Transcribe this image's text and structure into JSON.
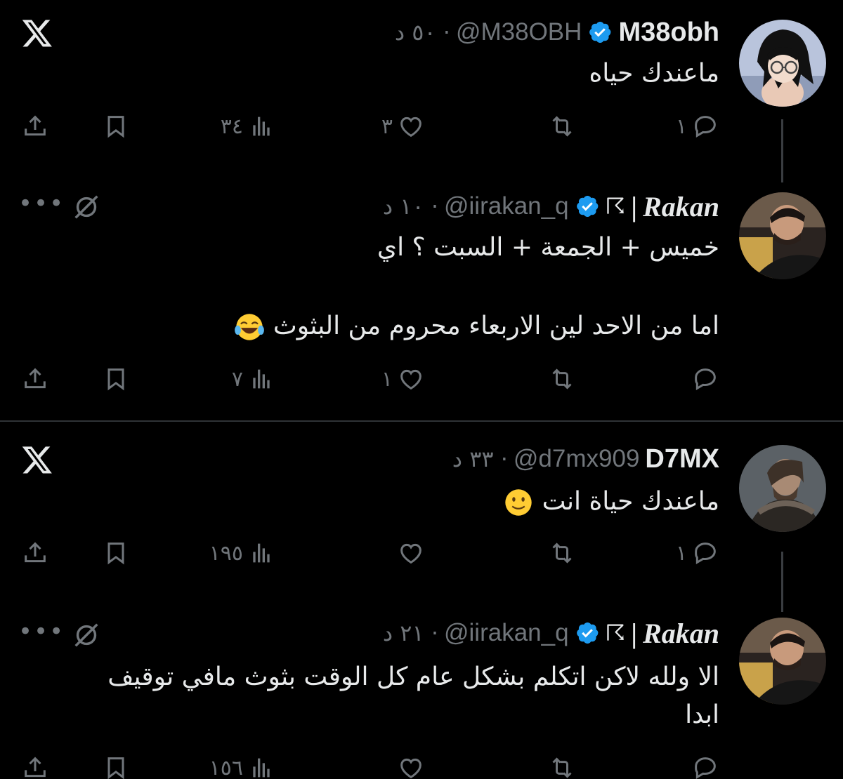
{
  "colors": {
    "background": "#000000",
    "text": "#e7e9ea",
    "secondary": "#71767b",
    "verified": "#1d9bf0",
    "divider": "#2f3336"
  },
  "post1": {
    "name": "M38obh",
    "handle": "@M38OBH",
    "time": "· ٥٠ د",
    "text": "ماعندك حياه",
    "reply_count": "١",
    "like_count": "٣",
    "views": "٣٤",
    "icons": [
      "x-logo-icon",
      "verified-badge-icon",
      "reply-icon",
      "retweet-icon",
      "like-icon",
      "views-icon",
      "bookmark-icon",
      "share-icon"
    ]
  },
  "reply1": {
    "name": "Rakan",
    "separator": "|",
    "flag": "☈",
    "handle": "@iirakan_q",
    "time": "· ١٠ د",
    "text_line1": "خميس + الجمعة + السبت ؟ اي",
    "text_line2": "اما من الاحد لين الاربعاء محروم من البثوث",
    "reply_count": "",
    "like_count": "١",
    "views": "٧",
    "icons": [
      "more-icon",
      "muted-icon",
      "laughing-emoji-icon"
    ]
  },
  "post2": {
    "name": "D7MX",
    "handle": "@d7mx909",
    "time": "· ٣٣ د",
    "text": "ماعندك حياة انت",
    "reply_count": "١",
    "like_count": "",
    "views": "١٩٥",
    "icons": [
      "x-logo-icon",
      "smile-emoji-icon"
    ]
  },
  "reply2": {
    "name": "Rakan",
    "separator": "|",
    "flag": "☈",
    "handle": "@iirakan_q",
    "time": "· ٢١ د",
    "text_line1": "الا ولله لاكن اتكلم بشكل عام كل الوقت بثوث مافي توقيف",
    "text_line2": "ابدا",
    "reply_count": "",
    "like_count": "",
    "views": "١٥٦"
  }
}
